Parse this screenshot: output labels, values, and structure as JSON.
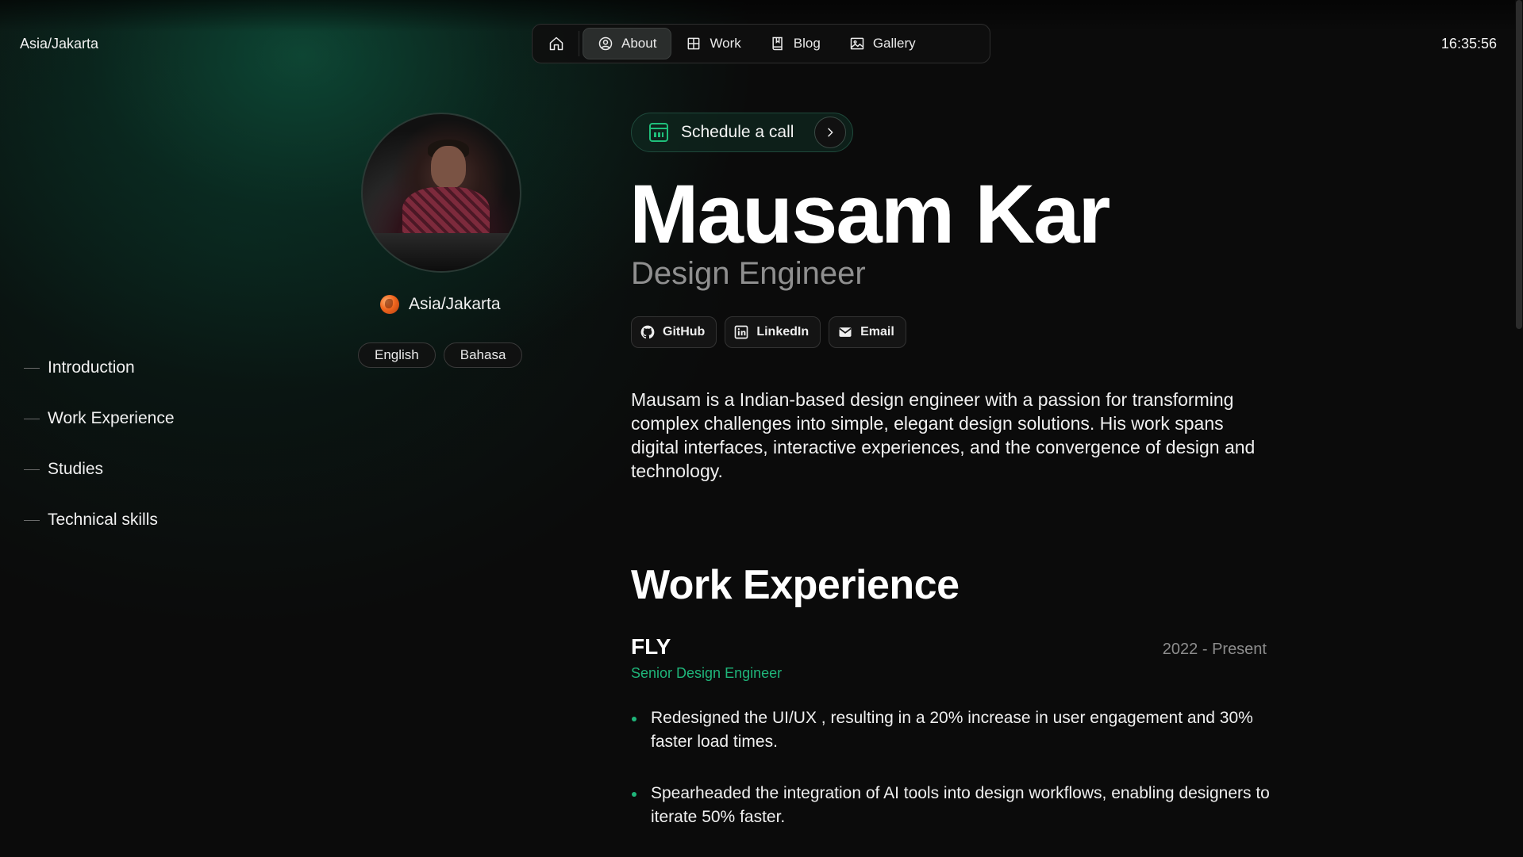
{
  "header": {
    "timezone": "Asia/Jakarta",
    "clock": "16:35:56"
  },
  "nav": {
    "items": [
      {
        "label": "",
        "icon": "home-icon"
      },
      {
        "label": "About",
        "icon": "user-circle-icon",
        "active": true
      },
      {
        "label": "Work",
        "icon": "grid-icon"
      },
      {
        "label": "Blog",
        "icon": "book-icon"
      },
      {
        "label": "Gallery",
        "icon": "image-icon"
      }
    ]
  },
  "toc": {
    "items": [
      {
        "label": "Introduction"
      },
      {
        "label": "Work Experience"
      },
      {
        "label": "Studies"
      },
      {
        "label": "Technical skills"
      }
    ]
  },
  "profile": {
    "location": "Asia/Jakarta",
    "languages": [
      "English",
      "Bahasa"
    ]
  },
  "schedule": {
    "label": "Schedule a call"
  },
  "hero": {
    "name": "Mausam Kar",
    "role": "Design Engineer"
  },
  "socials": [
    {
      "label": "GitHub",
      "icon": "github-icon"
    },
    {
      "label": "LinkedIn",
      "icon": "linkedin-icon"
    },
    {
      "label": "Email",
      "icon": "mail-icon"
    }
  ],
  "intro": "Mausam is a Indian-based design engineer with a passion for transforming complex challenges into simple, elegant design solutions. His work spans digital interfaces, interactive experiences, and the convergence of design and technology.",
  "work": {
    "title": "Work Experience",
    "jobs": [
      {
        "company": "FLY",
        "period": "2022 - Present",
        "role": "Senior Design Engineer",
        "bullets": [
          "Redesigned the UI/UX , resulting in a 20% increase in user engagement and 30% faster load times.",
          "Spearheaded the integration of AI tools into design workflows, enabling designers to iterate 50% faster."
        ]
      }
    ]
  },
  "colors": {
    "accent": "#1fb57a",
    "background": "#0b0b0b",
    "muted": "#8f8f8f"
  }
}
